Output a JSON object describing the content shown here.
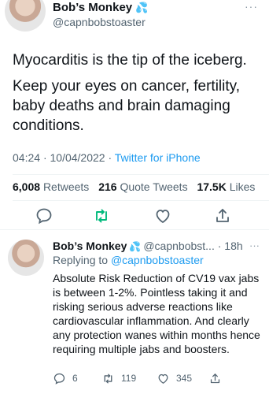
{
  "tweet": {
    "author_name": "Bob’s Monkey",
    "author_handle": "@capnbobstoaster",
    "name_emoji": "💦",
    "more": "···",
    "text_paragraph_1": "Myocarditis is the tip of the iceberg.",
    "text_paragraph_2": "Keep your eyes on cancer, fertility, baby deaths and brain damaging conditions.",
    "time": "04:24",
    "date": "10/04/2022",
    "separator": "·",
    "source": "Twitter for iPhone",
    "retweets_count": "6,008",
    "retweets_label": "Retweets",
    "quotes_count": "216",
    "quotes_label": "Quote Tweets",
    "likes_count": "17.5K",
    "likes_label": "Likes",
    "icons": [
      "reply-icon",
      "retweet-icon",
      "like-icon",
      "share-icon"
    ]
  },
  "reply": {
    "author_name": "Bob’s Monkey",
    "name_emoji": "💦",
    "author_handle": "@capnbobst...",
    "age": "18h",
    "separator": "·",
    "more": "···",
    "replying_prefix": "Replying to",
    "replying_to": "@capnbobstoaster",
    "text": "Absolute Risk Reduction of CV19 vax jabs is between 1-2%. Pointless taking it and risking serious adverse reactions like cardiovascular inflammation. And clearly any protection wanes within months hence requiring multiple jabs and boosters.",
    "reply_count": "6",
    "retweet_count": "119",
    "like_count": "345"
  },
  "colors": {
    "accent": "#1d9bf0",
    "retweet_green": "#00ba7c",
    "text": "#0f1419",
    "secondary": "#536471"
  }
}
